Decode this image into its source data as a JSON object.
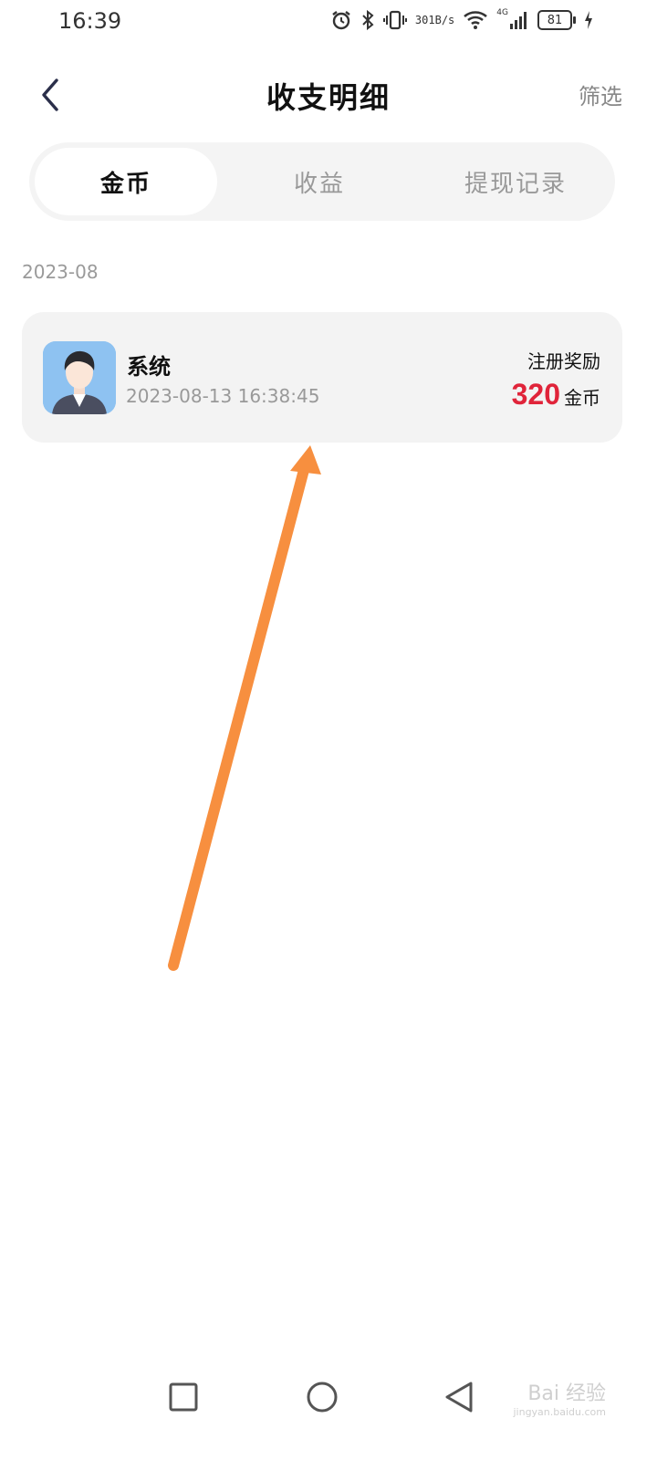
{
  "status_bar": {
    "time": "16:39",
    "net_speed_value": "301",
    "net_speed_unit": "B/s",
    "network_type": "4G",
    "battery_level": "81",
    "icons": [
      "alarm-icon",
      "bluetooth-icon",
      "vibrate-icon",
      "wifi-icon",
      "signal-icon",
      "battery-icon",
      "charging-icon"
    ]
  },
  "header": {
    "title": "收支明细",
    "filter_label": "筛选",
    "back_icon": "chevron-left-icon"
  },
  "tabs": [
    {
      "label": "金币",
      "active": true
    },
    {
      "label": "收益",
      "active": false
    },
    {
      "label": "提现记录",
      "active": false
    }
  ],
  "records": {
    "month": "2023-08",
    "items": [
      {
        "name": "系统",
        "time": "2023-08-13 16:38:45",
        "type": "注册奖励",
        "amount": "320",
        "unit": "金币",
        "amount_color": "#e0243a"
      }
    ]
  },
  "annotation": {
    "arrow_color": "#f78f3f"
  },
  "nav_bar": {
    "icons": [
      "square-icon",
      "circle-icon",
      "triangle-back-icon"
    ]
  },
  "watermark": {
    "text": "Bai 经验",
    "subtext": "jingyan.baidu.com"
  }
}
